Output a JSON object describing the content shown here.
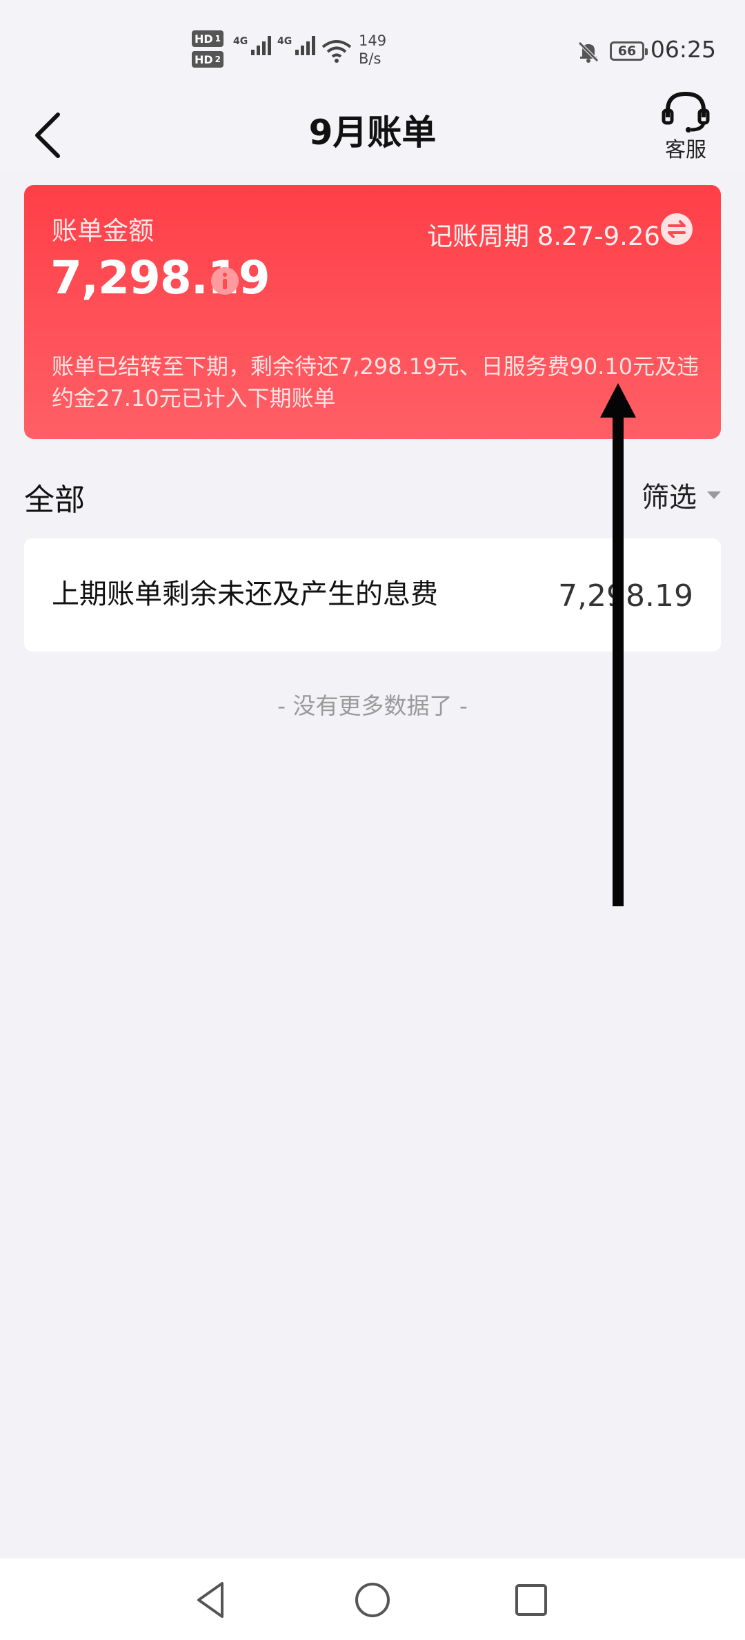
{
  "status_bar": {
    "hd1": "HD",
    "hd1_sub": "1",
    "hd2": "HD",
    "hd2_sub": "2",
    "net1": "4G",
    "net2": "4G",
    "speed_value": "149",
    "speed_unit": "B/s",
    "battery": "66",
    "time": "06:25"
  },
  "header": {
    "title": "9月账单",
    "service_label": "客服"
  },
  "bill_card": {
    "amount_label": "账单金额",
    "amount": "7,298.19",
    "period_label": "记账周期 8.27-9.26",
    "note": "账单已结转至下期，剩余待还7,298.19元、日服务费90.10元及违约金27.10元已计入下期账单",
    "background_color": "#ff4a52"
  },
  "filter_row": {
    "all_label": "全部",
    "filter_label": "筛选"
  },
  "items": [
    {
      "title": "上期账单剩余未还及产生的息费",
      "amount": "7,298.19"
    }
  ],
  "list_footer": "- 没有更多数据了 -",
  "icons": {
    "back": "chevron-left-icon",
    "service": "headset-icon",
    "info": "info-icon",
    "swap": "swap-icon",
    "filter": "caret-down-icon",
    "annotation": "up-arrow-annotation",
    "nav_back": "triangle-back-icon",
    "nav_home": "circle-home-icon",
    "nav_recent": "square-recent-icon"
  }
}
